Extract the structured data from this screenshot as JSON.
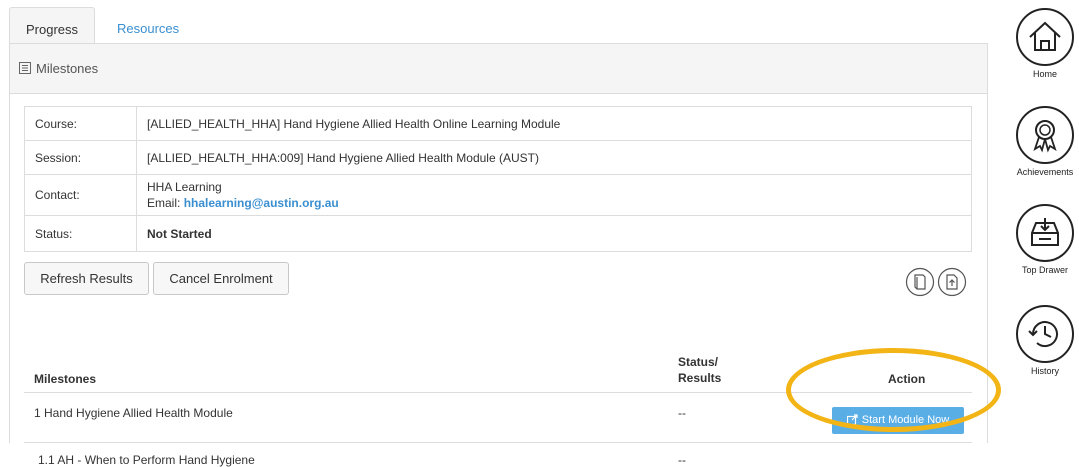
{
  "tabs": {
    "progress": "Progress",
    "resources": "Resources"
  },
  "panel": {
    "heading": "Milestones"
  },
  "details": {
    "course_label": "Course:",
    "course_value": "[ALLIED_HEALTH_HHA] Hand Hygiene Allied Health Online Learning Module",
    "session_label": "Session:",
    "session_value": "[ALLIED_HEALTH_HHA:009] Hand Hygiene Allied Health Module (AUST)",
    "contact_label": "Contact:",
    "contact_name": "HHA Learning",
    "email_prefix": "Email:",
    "email_value": "hhalearning@austin.org.au",
    "status_label": "Status:",
    "status_value": "Not Started"
  },
  "buttons": {
    "refresh": "Refresh Results",
    "cancel": "Cancel Enrolment"
  },
  "milestones": {
    "col_name": "Milestones",
    "col_status_1": "Status/",
    "col_status_2": "Results",
    "col_action": "Action",
    "rows": [
      {
        "name": "1 Hand Hygiene Allied Health Module",
        "status": "--",
        "action": "Start Module Now"
      },
      {
        "name": "1.1 AH - When to Perform Hand Hygiene",
        "status": "--"
      }
    ]
  },
  "side_nav": {
    "home": "Home",
    "achievements": "Achievements",
    "top_drawer": "Top Drawer",
    "history": "History"
  },
  "colors": {
    "accent": "#5aaee6",
    "link": "#3a8fd0",
    "highlight": "#f3b416"
  }
}
